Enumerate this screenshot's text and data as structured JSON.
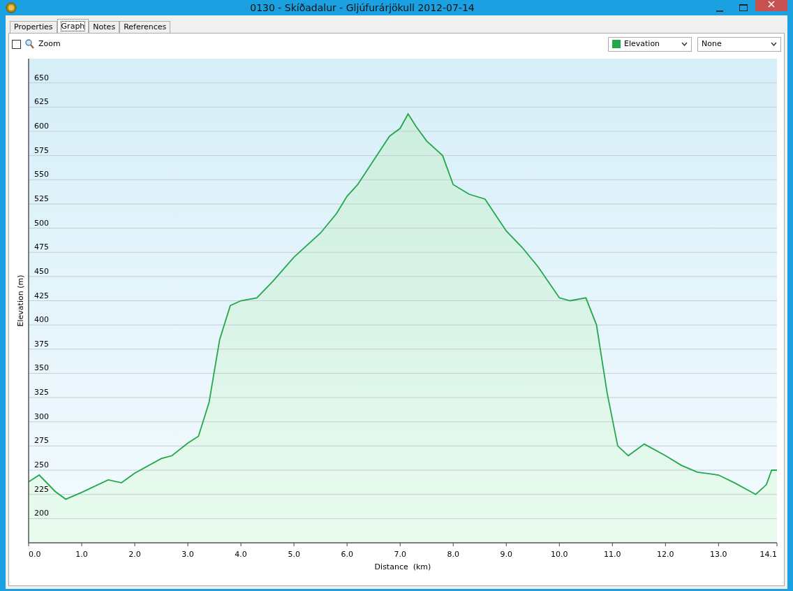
{
  "window": {
    "title": "0130 - Skíðadalur - Gljúfurárjökull 2012-07-14"
  },
  "tabs": [
    {
      "label": "Properties",
      "selected": false
    },
    {
      "label": "Graph",
      "selected": true
    },
    {
      "label": "Notes",
      "selected": false
    },
    {
      "label": "References",
      "selected": false
    }
  ],
  "zoom": {
    "label": "Zoom",
    "checked": false
  },
  "dropdowns": [
    {
      "value": "None"
    }
  ],
  "chart_data": {
    "type": "area",
    "grid": true,
    "xlabel": "Distance  (km)",
    "ylabel": "Elevation (m)",
    "x": [
      0,
      0.2,
      0.5,
      0.7,
      1.0,
      1.5,
      1.75,
      2.0,
      2.5,
      2.7,
      3.0,
      3.2,
      3.4,
      3.6,
      3.8,
      4.0,
      4.3,
      4.6,
      5.0,
      5.5,
      5.8,
      6.0,
      6.2,
      6.5,
      6.8,
      7.0,
      7.15,
      7.3,
      7.5,
      7.8,
      8.0,
      8.3,
      8.6,
      9.0,
      9.3,
      9.6,
      10.0,
      10.2,
      10.5,
      10.7,
      10.9,
      11.1,
      11.3,
      11.6,
      12.0,
      12.3,
      12.6,
      13.0,
      13.3,
      13.7,
      13.9,
      14.0,
      14.1
    ],
    "series": [
      {
        "name": "Elevation",
        "color": "#22a84a",
        "values": [
          238,
          245,
          228,
          220,
          227,
          240,
          237,
          247,
          262,
          265,
          278,
          285,
          320,
          385,
          420,
          425,
          428,
          445,
          470,
          495,
          515,
          533,
          545,
          570,
          595,
          603,
          618,
          605,
          590,
          575,
          545,
          535,
          530,
          497,
          480,
          460,
          428,
          425,
          428,
          400,
          330,
          275,
          265,
          277,
          265,
          255,
          248,
          245,
          237,
          225,
          235,
          250,
          250
        ]
      }
    ],
    "xlim": [
      0,
      14.1
    ],
    "ylim": [
      175,
      675
    ],
    "xticks": [
      {
        "value": 0,
        "label": "0.0"
      },
      {
        "value": 1,
        "label": "1.0"
      },
      {
        "value": 2,
        "label": "2.0"
      },
      {
        "value": 3,
        "label": "3.0"
      },
      {
        "value": 4,
        "label": "4.0"
      },
      {
        "value": 5,
        "label": "5.0"
      },
      {
        "value": 6,
        "label": "6.0"
      },
      {
        "value": 7,
        "label": "7.0"
      },
      {
        "value": 8,
        "label": "8.0"
      },
      {
        "value": 9,
        "label": "9.0"
      },
      {
        "value": 10,
        "label": "10.0"
      },
      {
        "value": 11,
        "label": "11.0"
      },
      {
        "value": 12,
        "label": "12.0"
      },
      {
        "value": 13,
        "label": "13.0"
      },
      {
        "value": 14.1,
        "label": "14.1"
      }
    ],
    "yticks": [
      200,
      225,
      250,
      275,
      300,
      325,
      350,
      375,
      400,
      425,
      450,
      475,
      500,
      525,
      550,
      575,
      600,
      625,
      650
    ]
  }
}
